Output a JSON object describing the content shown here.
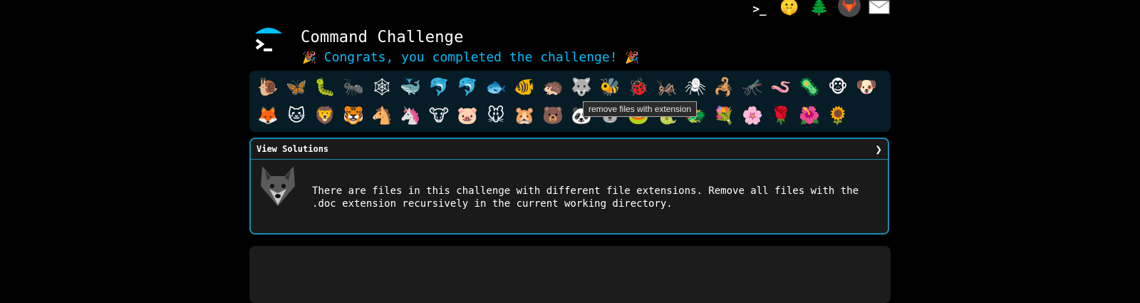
{
  "nav": {
    "icons": [
      {
        "name": "terminal",
        "glyph": ">_"
      },
      {
        "name": "shush-face",
        "glyph": "🤫"
      },
      {
        "name": "tree",
        "glyph": "🌲"
      },
      {
        "name": "gitlab-logo",
        "glyph": "🦊"
      },
      {
        "name": "mail",
        "glyph": "✉"
      }
    ]
  },
  "header": {
    "title": "Command Challenge",
    "congrats": "Congrats, you completed the challenge!",
    "party_left": "🎉",
    "party_right": "🎉"
  },
  "challenges": {
    "row1": [
      "🐌",
      "🦋",
      "🐛",
      "🐜",
      "🕸",
      "🐳",
      "🐬",
      "🐬",
      "🐟",
      "🐠",
      "🦔",
      "🐺",
      "🐝",
      "🐞",
      "🦗",
      "🕷",
      "🦂",
      "🦟",
      "🪱",
      "🦠",
      "🐵",
      "🐶"
    ],
    "row2": [
      "🦊",
      "🐱",
      "🦁",
      "🐯",
      "🐴",
      "🦄",
      "🐮",
      "🐷",
      "🐭",
      "🐹",
      "🐻",
      "🐼",
      "🐨",
      "🐸",
      "🐍",
      "🐲",
      "💐",
      "🌸",
      "🌹",
      "🌺",
      "🌻"
    ]
  },
  "tooltip": "remove files with extension",
  "solutions": {
    "label": "View Solutions",
    "chevron": "❯"
  },
  "challenge": {
    "description": "There are files in this challenge with different file extensions. Remove all files with the .doc extension recursively in the current working directory."
  },
  "colors": {
    "accent": "#00bfff",
    "border": "#1a8ab0",
    "bar_bg": "#061c26",
    "panel_bg": "#1a1a1a"
  }
}
